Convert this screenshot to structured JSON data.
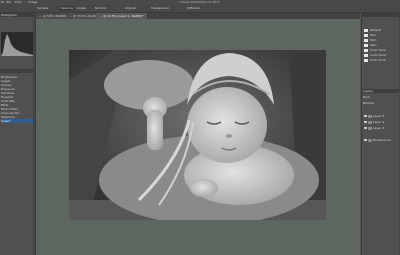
{
  "app": {
    "title": "Adobe Photoshop CC 2017"
  },
  "menubar": {
    "items": [
      "Ps",
      "File",
      "Edit",
      "Image"
    ]
  },
  "options": {
    "items": [
      "Sample",
      "Spacing",
      "Angle",
      "Normal",
      "Aligned",
      "Transparent",
      "Diffusion"
    ]
  },
  "tabs": [
    {
      "label": "… @ 50% (RGB/8)"
    },
    {
      "label": "… @ 33.3% (RGB/8)"
    },
    {
      "label": "… @ 22.8% (Layer 1, RGB/8)*"
    }
  ],
  "left_panel": {
    "header": "Histogram",
    "adjustments": [
      "Brightness",
      "Levels",
      "Curves",
      "Exposure",
      "Vibrance",
      "Hue/Sat",
      "Color Bal",
      "B&W",
      "Photo Filter",
      "Channel Mix",
      "Selective",
      "Invert"
    ]
  },
  "right_panel": {
    "layers_header": "Layers",
    "kind_label": "Kind",
    "mode_label": "Normal",
    "layers": [
      "Layer 5",
      "Layer 4",
      "Layer 3",
      "Background"
    ],
    "swatch_labels": [
      "Default",
      "Skin",
      "Skin",
      "Skin",
      "Color Tone",
      "Color Tone",
      "Color Tone"
    ]
  },
  "colors": {
    "canvas_bg": "#5e6660",
    "ui_bg": "#535353",
    "accent": "#2f5f92"
  },
  "icons": {
    "eye": "eye-icon",
    "layer": "layer-thumb"
  }
}
